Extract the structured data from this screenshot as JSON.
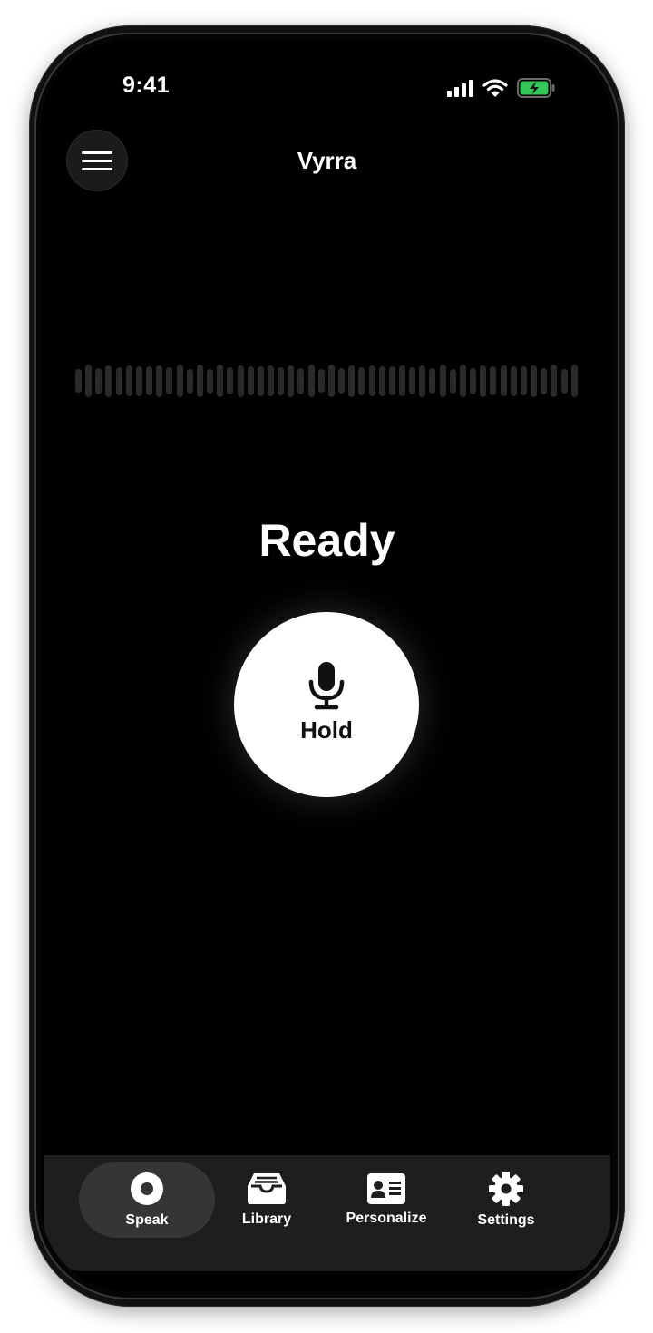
{
  "status_bar": {
    "time": "9:41"
  },
  "header": {
    "title": "Vyrra"
  },
  "main": {
    "state": "Ready",
    "hold_label": "Hold"
  },
  "tabs": [
    {
      "label": "Speak",
      "icon": "record-icon",
      "active": true
    },
    {
      "label": "Library",
      "icon": "tray-icon",
      "active": false
    },
    {
      "label": "Personalize",
      "icon": "id-card-icon",
      "active": false
    },
    {
      "label": "Settings",
      "icon": "gear-icon",
      "active": false
    }
  ],
  "colors": {
    "background": "#000000",
    "battery": "#34c759",
    "tabbar": "#1e1e1e",
    "active_tab": "#353535"
  }
}
